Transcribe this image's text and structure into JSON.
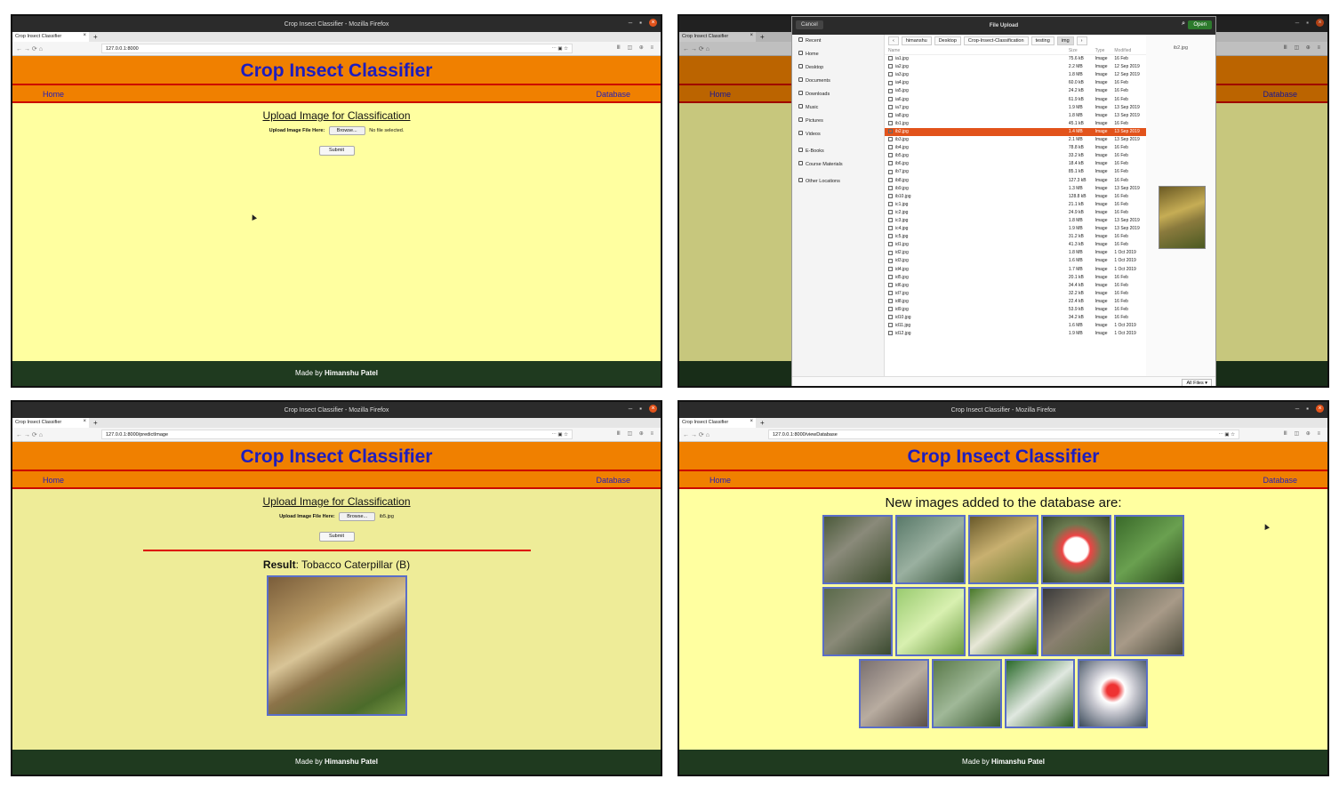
{
  "browser": {
    "window_title": "Crop Insect Classifier - Mozilla Firefox",
    "tab_title": "Crop Insect Classifier",
    "tab_close": "×",
    "new_tab": "+",
    "url_home": "127.0.0.1:8000",
    "url_predict": "127.0.0.1:8000/predictImage",
    "url_database": "127.0.0.1:8000/viewDatabase",
    "nav_icons": "← → ⟳ ⌂",
    "right_icons": "⋯ ▣ ☆",
    "toolbar_icons": "Ⅲ ◫ ⊕ ≡",
    "minimize": "–",
    "maximize": "▪",
    "close": "×"
  },
  "site": {
    "brand": "Crop Insect Classifier",
    "nav_home": "Home",
    "nav_database": "Database",
    "upload_title": "Upload Image for Classification",
    "upload_label": "Upload Image File Here:",
    "browse_label": "Browse...",
    "no_file": "No file selected.",
    "selected_file": "ib5.jpg",
    "submit_label": "Submit",
    "footer_prefix": "Made by",
    "footer_author": "Himanshu Patel",
    "result_label": "Result",
    "result_value": ": Tobacco Caterpillar (B)",
    "db_title": "New images added to the database are:"
  },
  "dialog": {
    "title": "File Upload",
    "cancel": "Cancel",
    "open": "Open",
    "search_icon": "magnifier-icon",
    "places": [
      "Recent",
      "Home",
      "Desktop",
      "Documents",
      "Downloads",
      "Music",
      "Pictures",
      "Videos"
    ],
    "bookmarks": [
      "E-Books",
      "Course Materials"
    ],
    "other": "Other Locations",
    "breadcrumbs": [
      "himanshu",
      "Desktop",
      "Crop-Insect-Classification",
      "testing",
      "img"
    ],
    "crumb_back": "‹",
    "crumb_fwd": "›",
    "columns": {
      "name": "Name",
      "size": "Size",
      "type": "Type",
      "modified": "Modified"
    },
    "files": [
      [
        "ia1.jpg",
        "75.6 kB",
        "Image",
        "16 Feb"
      ],
      [
        "ia2.jpg",
        "2.2 MB",
        "Image",
        "12 Sep 2019"
      ],
      [
        "ia3.jpg",
        "1.8 MB",
        "Image",
        "12 Sep 2019"
      ],
      [
        "ia4.jpg",
        "60.0 kB",
        "Image",
        "16 Feb"
      ],
      [
        "ia5.jpg",
        "24.2 kB",
        "Image",
        "16 Feb"
      ],
      [
        "ia6.jpg",
        "61.9 kB",
        "Image",
        "16 Feb"
      ],
      [
        "ia7.jpg",
        "1.9 MB",
        "Image",
        "13 Sep 2019"
      ],
      [
        "ia8.jpg",
        "1.8 MB",
        "Image",
        "13 Sep 2019"
      ],
      [
        "ib1.jpg",
        "45.1 kB",
        "Image",
        "16 Feb"
      ],
      [
        "ib2.jpg",
        "1.4 MB",
        "Image",
        "13 Sep 2019"
      ],
      [
        "ib3.jpg",
        "2.1 MB",
        "Image",
        "13 Sep 2019"
      ],
      [
        "ib4.jpg",
        "78.8 kB",
        "Image",
        "16 Feb"
      ],
      [
        "ib5.jpg",
        "33.2 kB",
        "Image",
        "16 Feb"
      ],
      [
        "ib6.jpg",
        "18.4 kB",
        "Image",
        "16 Feb"
      ],
      [
        "ib7.jpg",
        "85.1 kB",
        "Image",
        "16 Feb"
      ],
      [
        "ib8.jpg",
        "127.3 kB",
        "Image",
        "16 Feb"
      ],
      [
        "ib9.jpg",
        "1.3 MB",
        "Image",
        "13 Sep 2019"
      ],
      [
        "ib10.jpg",
        "128.8 kB",
        "Image",
        "16 Feb"
      ],
      [
        "ic1.jpg",
        "21.1 kB",
        "Image",
        "16 Feb"
      ],
      [
        "ic2.jpg",
        "24.9 kB",
        "Image",
        "16 Feb"
      ],
      [
        "ic3.jpg",
        "1.8 MB",
        "Image",
        "13 Sep 2019"
      ],
      [
        "ic4.jpg",
        "1.9 MB",
        "Image",
        "13 Sep 2019"
      ],
      [
        "ic5.jpg",
        "31.2 kB",
        "Image",
        "16 Feb"
      ],
      [
        "id1.jpg",
        "41.3 kB",
        "Image",
        "16 Feb"
      ],
      [
        "id2.jpg",
        "1.8 MB",
        "Image",
        "1 Oct 2019"
      ],
      [
        "id3.jpg",
        "1.6 MB",
        "Image",
        "1 Oct 2019"
      ],
      [
        "id4.jpg",
        "1.7 MB",
        "Image",
        "1 Oct 2019"
      ],
      [
        "id5.jpg",
        "20.1 kB",
        "Image",
        "16 Feb"
      ],
      [
        "id6.jpg",
        "34.4 kB",
        "Image",
        "16 Feb"
      ],
      [
        "id7.jpg",
        "32.2 kB",
        "Image",
        "16 Feb"
      ],
      [
        "id8.jpg",
        "22.4 kB",
        "Image",
        "16 Feb"
      ],
      [
        "id9.jpg",
        "53.9 kB",
        "Image",
        "16 Feb"
      ],
      [
        "id10.jpg",
        "34.2 kB",
        "Image",
        "16 Feb"
      ],
      [
        "id11.jpg",
        "1.6 MB",
        "Image",
        "1 Oct 2019"
      ],
      [
        "id12.jpg",
        "1.9 MB",
        "Image",
        "1 Oct 2019"
      ]
    ],
    "selected_file": "ib2.jpg",
    "preview_name": "ib2.jpg",
    "filter": "All Files ▾"
  },
  "database_thumbnails": 14,
  "colors": {
    "header": "#f08000",
    "brand_text": "#1d1dbf",
    "page_bg": "#ffffa0",
    "footer_bg": "#1f3a1f",
    "selection": "#e2531b"
  }
}
